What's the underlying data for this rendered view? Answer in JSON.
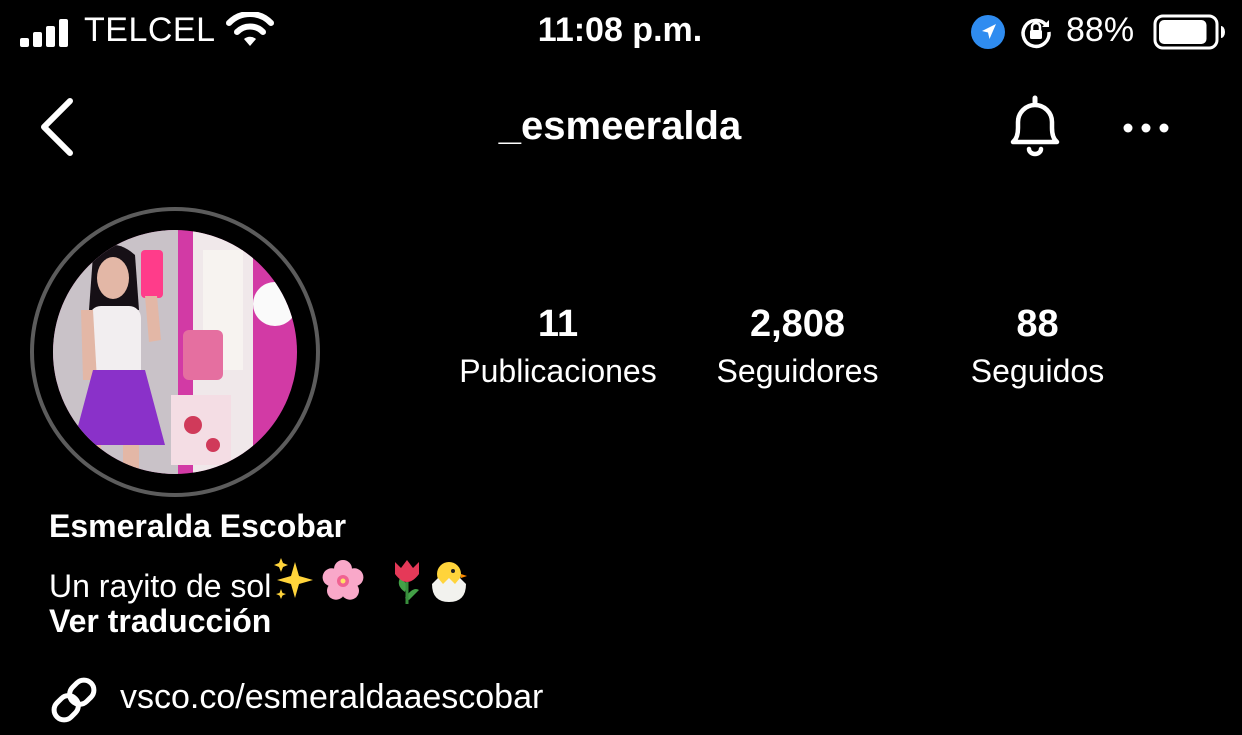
{
  "status_bar": {
    "carrier": "TELCEL",
    "time": "11:08 p.m.",
    "battery_percent": "88%",
    "battery_level": 0.88,
    "icons": [
      "cellular-signal-icon",
      "wifi-icon",
      "location-icon",
      "lock-rotation-icon",
      "battery-icon"
    ]
  },
  "nav": {
    "username": "_esmeeralda",
    "icons": [
      "back-chevron-icon",
      "bell-icon",
      "more-options-icon"
    ]
  },
  "profile": {
    "stats": {
      "posts_count": "11",
      "posts_label": "Publicaciones",
      "followers_count": "2,808",
      "followers_label": "Seguidores",
      "following_count": "88",
      "following_label": "Seguidos"
    },
    "display_name": "Esmeralda Escobar",
    "bio_text": "Un rayito de sol",
    "bio_emojis": [
      "sparkles",
      "cherry-blossom",
      "tulip",
      "hatching-chick"
    ],
    "see_translation": "Ver traducción",
    "link": "vsco.co/esmeraldaaescobar"
  },
  "colors": {
    "background": "#000000",
    "text": "#ffffff",
    "avatar_ring": "#5c5c5c",
    "location_badge": "#2f8cf0"
  }
}
